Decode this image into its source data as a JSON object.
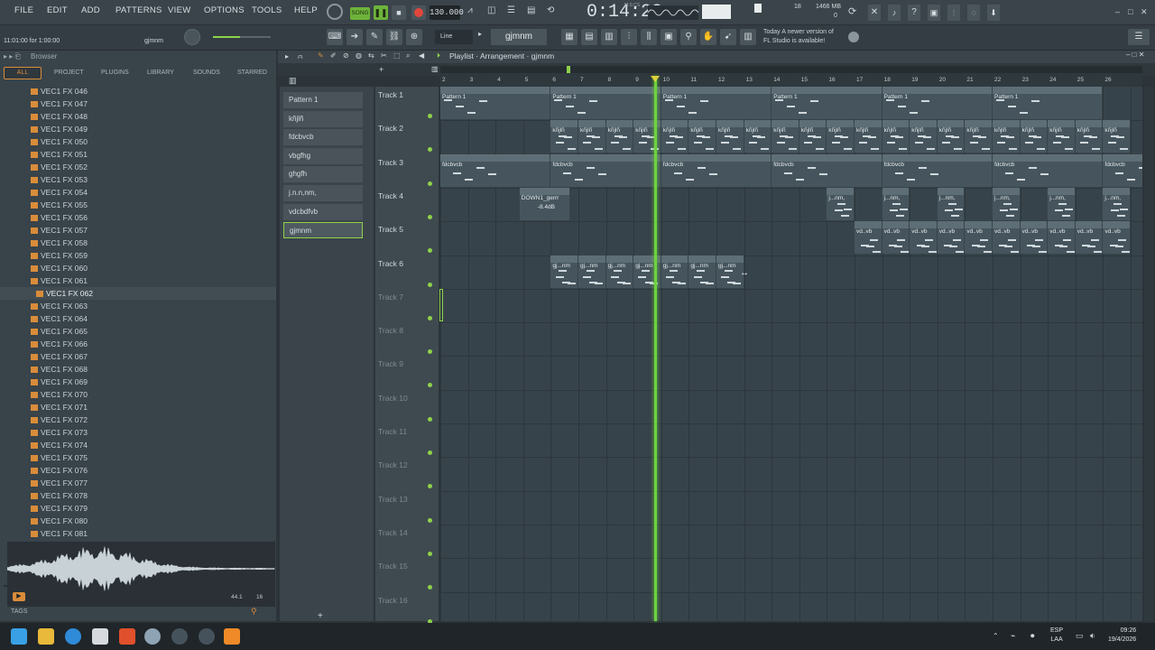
{
  "menu": {
    "file": "FILE",
    "edit": "EDIT",
    "add": "ADD",
    "patterns": "PATTERNS",
    "view": "VIEW",
    "options": "OPTIONS",
    "tools": "TOOLS",
    "help": "HELP"
  },
  "transport": {
    "song_label": "SONG",
    "tempo": "130.000",
    "time": "0:14:23",
    "time_unit": "M:S:CS",
    "cpu": "18",
    "memory": "1466 MB",
    "memory_label": "0"
  },
  "hint": {
    "left": "11:01:00 for 1:00:00",
    "pattern": "gjmnm"
  },
  "toolbar2": {
    "snap": "Line",
    "pattern_name": "gjmnm"
  },
  "news": {
    "line1": "Today  A newer version of",
    "line2": "FL Studio is available!"
  },
  "browser": {
    "title": "Browser",
    "tabs": [
      "ALL",
      "PROJECT",
      "PLUGINS",
      "LIBRARY",
      "SOUNDS",
      "STARRED"
    ],
    "items": [
      "VEC1 FX 046",
      "VEC1 FX 047",
      "VEC1 FX 048",
      "VEC1 FX 049",
      "VEC1 FX 050",
      "VEC1 FX 051",
      "VEC1 FX 052",
      "VEC1 FX 053",
      "VEC1 FX 054",
      "VEC1 FX 055",
      "VEC1 FX 056",
      "VEC1 FX 057",
      "VEC1 FX 058",
      "VEC1 FX 059",
      "VEC1 FX 060",
      "VEC1 FX 061",
      "VEC1 FX 062",
      "VEC1 FX 063",
      "VEC1 FX 064",
      "VEC1 FX 065",
      "VEC1 FX 066",
      "VEC1 FX 067",
      "VEC1 FX 068",
      "VEC1 FX 069",
      "VEC1 FX 070",
      "VEC1 FX 071",
      "VEC1 FX 072",
      "VEC1 FX 073",
      "VEC1 FX 074",
      "VEC1 FX 075",
      "VEC1 FX 076",
      "VEC1 FX 077",
      "VEC1 FX 078",
      "VEC1 FX 079",
      "VEC1 FX 080",
      "VEC1 FX 081"
    ],
    "selected": "VEC1 FX 062",
    "wave_info": "44.1 ",
    "wave_bits": "16",
    "tags": "TAGS"
  },
  "playlist": {
    "title": "Playlist · Arrangement · gjmnm"
  },
  "picker": [
    "Pattern 1",
    "kñjlñ",
    "fdcbvcb",
    "vbgfhg",
    "ghgfh",
    "j.n.n,nm,",
    "vdcbdfvb",
    "gjmnm"
  ],
  "tracks": [
    "Track 1",
    "Track 2",
    "Track 3",
    "Track 4",
    "Track 5",
    "Track 6",
    "Track 7",
    "Track 8",
    "Track 9",
    "Track 10",
    "Track 11",
    "Track 12",
    "Track 13",
    "Track 14",
    "Track 15",
    "Track 16"
  ],
  "ruler": [
    "2",
    "3",
    "4",
    "5",
    "6",
    "7",
    "8",
    "9",
    "10",
    "11",
    "12",
    "13",
    "14",
    "15",
    "16",
    "17",
    "18",
    "19",
    "20",
    "21",
    "22",
    "23",
    "24",
    "25",
    "26"
  ],
  "clips": {
    "track1": "Pattern 1",
    "track2": "kñjlñ",
    "track3": "fdcbvcb",
    "track4_audio": "DOWN1_gerrr",
    "track4_vol": "-8.4dB",
    "track4": "j...nm,",
    "track5": "vd..vb",
    "track6": "gj...nm"
  },
  "taskbar": {
    "lang1": "ESP",
    "lang2": "LAA",
    "time": "09:26",
    "date": "19/4/2026"
  },
  "colors": {
    "accent": "#6dd241",
    "orange": "#d98c3a",
    "bg": "#2c3439"
  }
}
